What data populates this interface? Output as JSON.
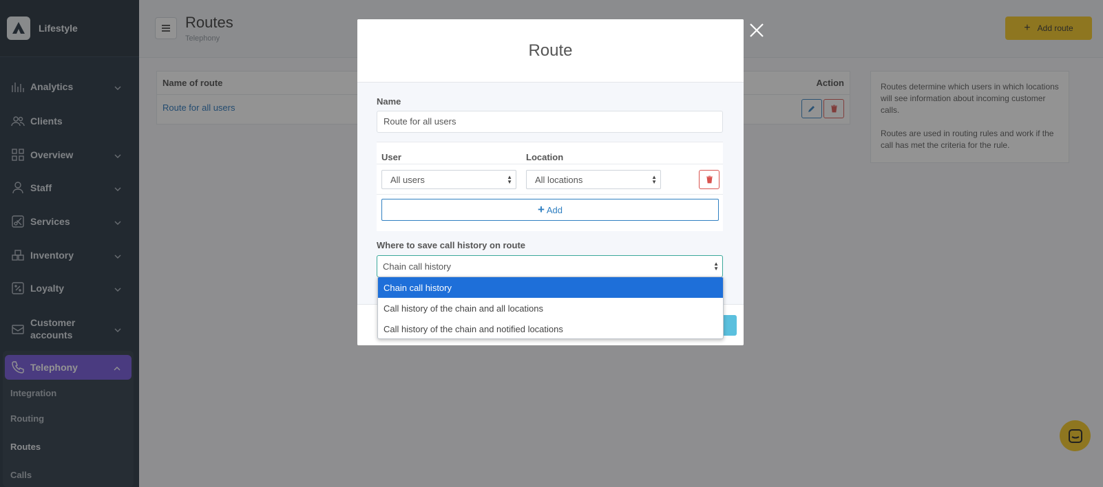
{
  "brand": {
    "name": "Lifestyle"
  },
  "sidebar": {
    "items": [
      {
        "label": "Analytics",
        "icon": "analytics-icon",
        "expandable": true
      },
      {
        "label": "Clients",
        "icon": "users-icon",
        "expandable": false
      },
      {
        "label": "Overview",
        "icon": "grid-icon",
        "expandable": true
      },
      {
        "label": "Staff",
        "icon": "person-icon",
        "expandable": true
      },
      {
        "label": "Services",
        "icon": "scissors-icon",
        "expandable": true
      },
      {
        "label": "Inventory",
        "icon": "boxes-icon",
        "expandable": true
      },
      {
        "label": "Loyalty",
        "icon": "percent-icon",
        "expandable": true
      },
      {
        "label": "Customer accounts",
        "icon": "wallet-icon",
        "expandable": true
      },
      {
        "label": "Telephony",
        "icon": "phone-icon",
        "expandable": true,
        "active": true
      }
    ],
    "submenu": [
      "Integration",
      "Routing",
      "Routes",
      "Calls"
    ],
    "current_sub": "Routes"
  },
  "header": {
    "title": "Routes",
    "subtitle": "Telephony",
    "add_button": "Add route"
  },
  "table": {
    "columns": [
      "Name of route",
      "Action"
    ],
    "rows": [
      {
        "name": "Route for all users"
      }
    ]
  },
  "info": {
    "p1": "Routes determine which users in which locations will see information about incoming customer calls.",
    "p2": "Routes are used in routing rules and work if the call has met the criteria for the rule."
  },
  "modal": {
    "title": "Route",
    "name_label": "Name",
    "name_value": "Route for all users",
    "user_col": "User",
    "location_col": "Location",
    "user_value": "All users",
    "location_value": "All locations",
    "add_label": "Add",
    "history_label": "Where to save call history on route",
    "history_value": "Chain call history",
    "options": [
      "Chain call history",
      "Call history of the chain and all locations",
      "Call history of the chain and notified locations"
    ]
  },
  "colors": {
    "accent": "#6c4fd8",
    "sidebar_bg": "#1d2a38",
    "primary_button": "#f5c518",
    "link": "#1e6fb8",
    "danger": "#d9534f",
    "selected_option": "#1e6fd9"
  }
}
